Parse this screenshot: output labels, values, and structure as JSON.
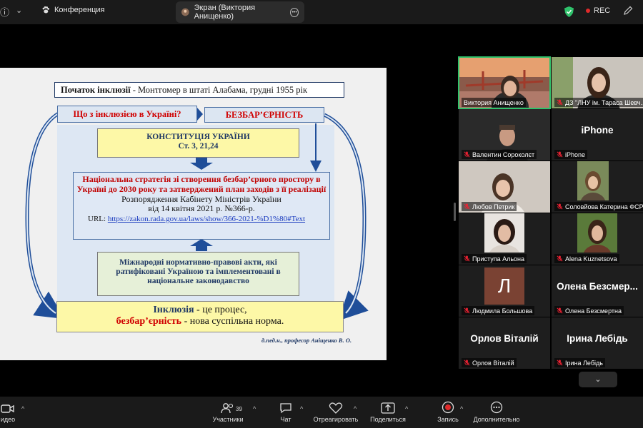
{
  "topbar": {
    "info_icon": "ⓘ",
    "chevron": "⌄",
    "meeting_name": "Конференция",
    "screen_tab": "Экран (Виктория Анищенко)",
    "more_icon": "•••",
    "rec_label": "REC"
  },
  "slide": {
    "start_bold": "Початок інклюзії",
    "start_rest": " - Монтгомер в штаті Алабама, грудні 1955 рік",
    "what": "Що з інклюзією в Україні?",
    "bez": "БЕЗБАР’ЄРНІСТЬ",
    "const_title": "КОНСТИТУЦІЯ УКРАЇНИ",
    "const_articles": "Ст. 3, 21,24",
    "strat_red": "Національна стратегія зі створення безбар’єрного простору в Україні до 2030 року та затверджений план заходів з її реалізації",
    "strat_order": "Розпорядження Кабінету Міністрів України",
    "strat_date": "від 14 квітня 2021 р. №366-р.",
    "url_label": "URL: ",
    "url": "https://zakon.rada.gov.ua/laws/show/366-2021-%D1%80#Text",
    "intl": "Міжнародні нормативно-правові акти, які ратифіковані Україною та імплементовані в національне законодавство",
    "incl_word": "Інклюзія",
    "incl_rest": " - це процес,",
    "bez_word": "безбар’єрність",
    "bez_rest": " - нова суспільна норма.",
    "author": "д.пед.н., професор Аніщенко В. О."
  },
  "participants": [
    {
      "name": "Виктория Анищенко",
      "muted": false,
      "kind": "video",
      "active": true
    },
    {
      "name": "ДЗ \"ЛНУ ім. Тараса Шевч...",
      "muted": true,
      "kind": "video"
    },
    {
      "name": "Валентин Сороколєт",
      "muted": true,
      "kind": "video"
    },
    {
      "name": "iPhone",
      "muted": true,
      "kind": "text",
      "big": "iPhone"
    },
    {
      "name": "Любов Петрик",
      "muted": true,
      "kind": "video"
    },
    {
      "name": "Соловйова Катерина ФСР",
      "muted": true,
      "kind": "video"
    },
    {
      "name": "Приступа Альона",
      "muted": true,
      "kind": "video"
    },
    {
      "name": "Alena Kuznetsova",
      "muted": true,
      "kind": "video"
    },
    {
      "name": "Людмила Большова",
      "muted": true,
      "kind": "avatar",
      "initial": "Л"
    },
    {
      "name": "Олена Безсмертна",
      "muted": true,
      "kind": "text",
      "big": "Олена  Безсмер..."
    },
    {
      "name": "Орлов Віталій",
      "muted": true,
      "kind": "text",
      "big": "Орлов Віталій"
    },
    {
      "name": "Ірина Лебідь",
      "muted": true,
      "kind": "text",
      "big": "Ірина Лебідь"
    }
  ],
  "scroll_down": "⌄",
  "toolbar": {
    "video": "идео",
    "participants": "Участники",
    "participants_count": "39",
    "chat": "Чат",
    "react": "Отреагировать",
    "share": "Поделиться",
    "record": "Запись",
    "more": "Дополнительно",
    "caret": "^"
  },
  "colors": {
    "active_speaker": "#2fc26b",
    "rec_dot": "#e02a2a",
    "slide_red": "#d00000",
    "slide_navy": "#1f3864",
    "slide_yellow": "#fdf8a7"
  }
}
